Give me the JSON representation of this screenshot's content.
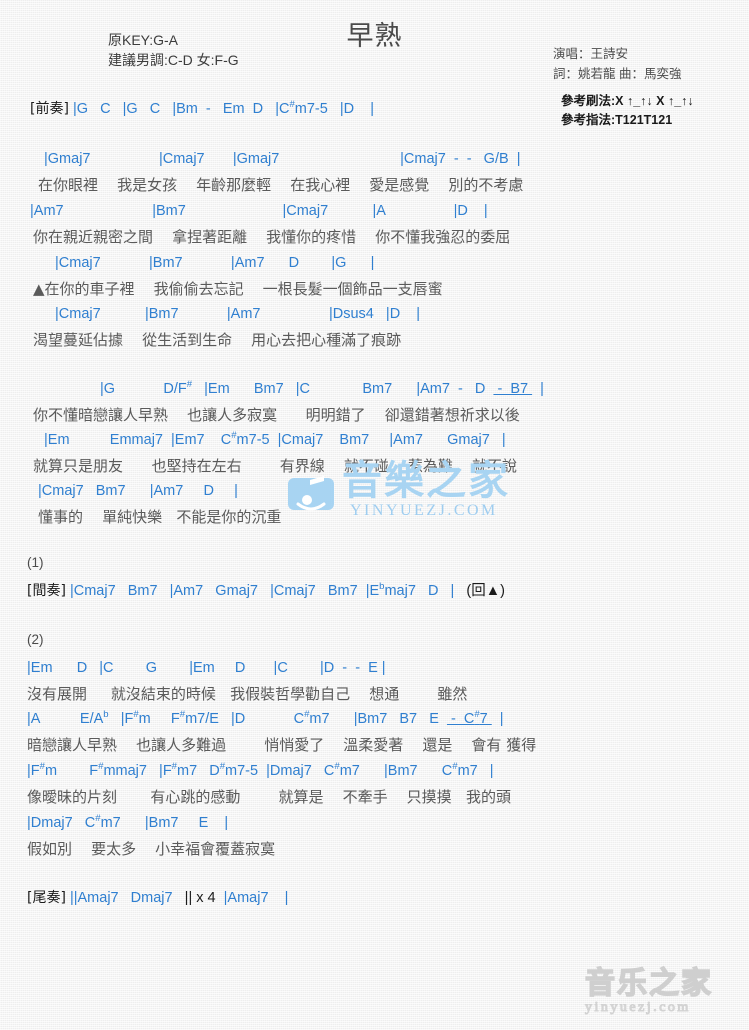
{
  "header": {
    "title": "早熟",
    "key_original": "原KEY:G-A",
    "key_suggested": "建議男調:C-D 女:F-G",
    "singer": "演唱：王詩安",
    "writers": "詞：姚若龍  曲：馬奕強",
    "strum_label": "參考刷法:",
    "strum_value": "X ↑_↑↓ X ↑_↑↓",
    "fingering_label": "參考指法:",
    "fingering_value": "T121T121"
  },
  "sections": {
    "intro_label": "[前奏]",
    "interlude_label": "[間奏]",
    "outro_label": "[尾奏]",
    "verse_marker_1": "(1)",
    "verse_marker_2": "(2)",
    "repeat_note": "(回▲)",
    "outro_repeat": "|| x 4"
  },
  "lines": [
    {
      "id": "intro",
      "type": "chord",
      "label": "[前奏]",
      "text": "|G    C    |G    C   |Bm  -   Em   D   |C#m7-5   |D    |"
    },
    {
      "id": "v1-c1",
      "type": "chord",
      "text": "|Gmaj7                      |Cmaj7        |Gmaj7                                  |Cmaj7  -  -   G/B  |"
    },
    {
      "id": "v1-l1",
      "type": "lyric",
      "text": "在你眼裡    我是女孩    年齡那麼輕    在我心裡    愛是感覺    別的不考慮"
    },
    {
      "id": "v1-c2",
      "type": "chord",
      "text": "|Am7                      |Bm7                        |Cmaj7            |A                  |D    |"
    },
    {
      "id": "v1-l2",
      "type": "lyric",
      "text": "你在親近親密之間    拿捏著距離    我懂你的疼惜    你不懂我強忍的委屈"
    },
    {
      "id": "v1-c3",
      "type": "chord",
      "text": "|Cmaj7            |Bm7            |Am7      D        |G      |"
    },
    {
      "id": "v1-l3",
      "type": "lyric",
      "text": "▲在你的車子裡    我偷偷去忘記    一根長髮一個飾品一支唇蜜"
    },
    {
      "id": "v1-c4",
      "type": "chord",
      "text": "|Cmaj7            |Bm7            |Am7                |Dsus4   |D    |"
    },
    {
      "id": "v1-l4",
      "type": "lyric",
      "text": "渴望蔓延佔據    從生活到生命    用心去把心種滿了痕跡"
    },
    {
      "id": "ch-c1",
      "type": "chord",
      "text": "|G            D/F#   |Em      Bm7   |C             Bm7       |Am7  -   D   -  B7  |"
    },
    {
      "id": "ch-l1",
      "type": "lyric",
      "text": "你不懂暗戀讓人早熟    也讓人多寂寞      明明錯了    卻還錯著想祈求以後"
    },
    {
      "id": "ch-c2",
      "type": "chord",
      "text": "|Em          Emmaj7  |Em7    C#m7-5  |Cmaj7    Bm7     |Am7      Gmaj7   |"
    },
    {
      "id": "ch-l2",
      "type": "lyric",
      "text": "就算只是朋友      也堅持在左右        有界線    就不碰    惹為難    就不說"
    },
    {
      "id": "ch-c3",
      "type": "chord",
      "text": "|Cmaj7   Bm7      |Am7     D     |"
    },
    {
      "id": "ch-l3",
      "type": "lyric",
      "text": "懂事的    單純快樂   不能是你的沉重"
    },
    {
      "id": "interlude",
      "type": "chord",
      "label": "[間奏]",
      "text": "|Cmaj7   Bm7   |Am7   Gmaj7   |Cmaj7   Bm7  |Ebmaj7   D   |   (回▲)"
    },
    {
      "id": "v2-c1",
      "type": "chord",
      "text": "|Em      D   |C        G        |Em     D       |C       |D  -  -  E |"
    },
    {
      "id": "v2-l1",
      "type": "lyric",
      "text": "沒有展開     就沒結束的時候   我假裝哲學勸自己    想通        雖然"
    },
    {
      "id": "v2-c2",
      "type": "chord",
      "text": "|A          E/Ab   |F#m     F#m7/E   |D            C#m7      |Bm7   B7   E   -  C#7  |"
    },
    {
      "id": "v2-l2",
      "type": "lyric",
      "text": "暗戀讓人早熟    也讓人多難過        悄悄愛了    溫柔愛著    還是    會有 獲得"
    },
    {
      "id": "v2-c3",
      "type": "chord",
      "text": "|F#m        F#mmaj7   |F#m7   D#m7-5  |Dmaj7   C#m7      |Bm7      C#m7   |"
    },
    {
      "id": "v2-l3",
      "type": "lyric",
      "text": "像曖昧的片刻       有心跳的感動        就算是    不牽手    只摸摸   我的頭"
    },
    {
      "id": "v2-c4",
      "type": "chord",
      "text": "|Dmaj7   C#m7      |Bm7     E    |"
    },
    {
      "id": "v2-l4",
      "type": "lyric",
      "text": "假如別    要太多    小幸福會覆蓋寂寞"
    },
    {
      "id": "outro",
      "type": "chord",
      "label": "[尾奏]",
      "text": "||Amaj7   Dmaj7    || x 4  |Amaj7    |"
    }
  ],
  "watermark": {
    "main": "音樂之家",
    "sub": "YINYUEZJ.COM",
    "bottom_main": "音乐之家",
    "bottom_sub": "yinyuezj.com"
  },
  "colors": {
    "chord": "#2f7fd0",
    "lyric": "#5a5a5a",
    "label": "#1b1b1b",
    "watermark_blue": "#a8d4f2",
    "watermark_gray": "#dedede",
    "background": "#f4f4f4"
  }
}
